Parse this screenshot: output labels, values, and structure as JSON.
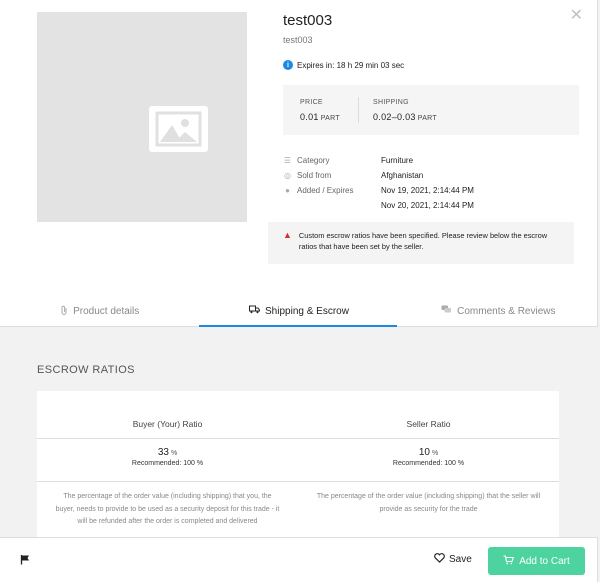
{
  "product": {
    "title": "test003",
    "subtitle": "test003",
    "expires": "Expires in: 18 h 29 min 03 sec"
  },
  "price": {
    "price_label": "PRICE",
    "price_value": "0.01",
    "price_unit": "PART",
    "shipping_label": "SHIPPING",
    "shipping_value": "0.02–0.03",
    "shipping_unit": "PART"
  },
  "details": [
    {
      "label": "Category",
      "value": "Furniture",
      "icon": "list-icon"
    },
    {
      "label": "Sold from",
      "value": "Afghanistan",
      "icon": "globe-icon"
    },
    {
      "label": "Added / Expires",
      "value": "Nov 19, 2021, 2:14:44 PM",
      "value2": "Nov 20, 2021, 2:14:44 PM",
      "icon": "clock-icon"
    }
  ],
  "warning": "Custom escrow ratios have been specified. Please review below the escrow ratios that have been set by the seller.",
  "tabs": [
    {
      "label": "Product details",
      "icon": "paperclip-icon"
    },
    {
      "label": "Shipping & Escrow",
      "icon": "truck-icon"
    },
    {
      "label": "Comments & Reviews",
      "icon": "comments-icon"
    }
  ],
  "escrow": {
    "section_title": "ESCROW RATIOS",
    "buyer": {
      "header": "Buyer (Your) Ratio",
      "value": "33",
      "unit": "%",
      "recommended": "Recommended: 100 %",
      "description": "The percentage of the order value (including shipping) that you, the buyer, needs to provide to be used as a security deposit for this trade - it will be refunded after the order is completed and delivered"
    },
    "seller": {
      "header": "Seller Ratio",
      "value": "10",
      "unit": "%",
      "recommended": "Recommended: 100 %",
      "description": "The percentage of the order value (including shipping) that the seller will provide as security for the trade"
    }
  },
  "footer": {
    "save_label": "Save",
    "cart_label": "Add to Cart"
  },
  "colors": {
    "accent": "#1e88e5",
    "cart": "#4cd3a0",
    "warning": "#d32f2f"
  }
}
